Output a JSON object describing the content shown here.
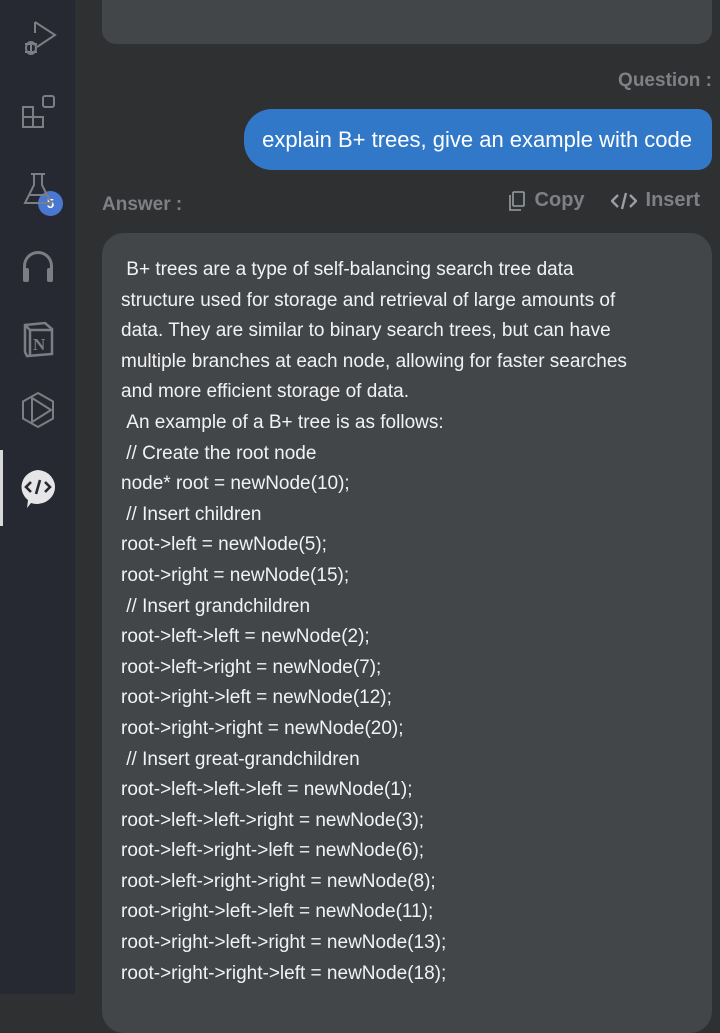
{
  "sidebar": {
    "items": [
      {
        "icon": "run-debug-icon"
      },
      {
        "icon": "extensions-icon",
        "badge": "5"
      },
      {
        "icon": "testing-flask-icon"
      },
      {
        "icon": "headphones-icon"
      },
      {
        "icon": "notion-icon"
      },
      {
        "icon": "play-hexagon-icon"
      },
      {
        "icon": "code-chat-icon",
        "active": true
      }
    ]
  },
  "chat": {
    "question_label": "Question :",
    "question": "explain B+ trees, give an example with code",
    "answer_label": "Answer :",
    "copy_label": "Copy",
    "insert_label": "Insert",
    "answer_lines": [
      " B+ trees are a type of self-balancing search tree data",
      "structure used for storage and retrieval of large amounts of",
      "data. They are similar to binary search trees, but can have",
      "multiple branches at each node, allowing for faster searches",
      "and more efficient storage of data.",
      " An example of a B+ tree is as follows:",
      " // Create the root node",
      "node* root = newNode(10);",
      " // Insert children",
      "root->left = newNode(5);",
      "root->right = newNode(15);",
      " // Insert grandchildren",
      "root->left->left = newNode(2);",
      "root->left->right = newNode(7);",
      "root->right->left = newNode(12);",
      "root->right->right = newNode(20);",
      " // Insert great-grandchildren",
      "root->left->left->left = newNode(1);",
      "root->left->left->right = newNode(3);",
      "root->left->right->left = newNode(6);",
      "root->left->right->right = newNode(8);",
      "root->right->left->left = newNode(11);",
      "root->right->left->right = newNode(13);",
      "root->right->right->left = newNode(18);"
    ]
  },
  "colors": {
    "accent": "#3179c8",
    "badge": "#4a78d0"
  }
}
